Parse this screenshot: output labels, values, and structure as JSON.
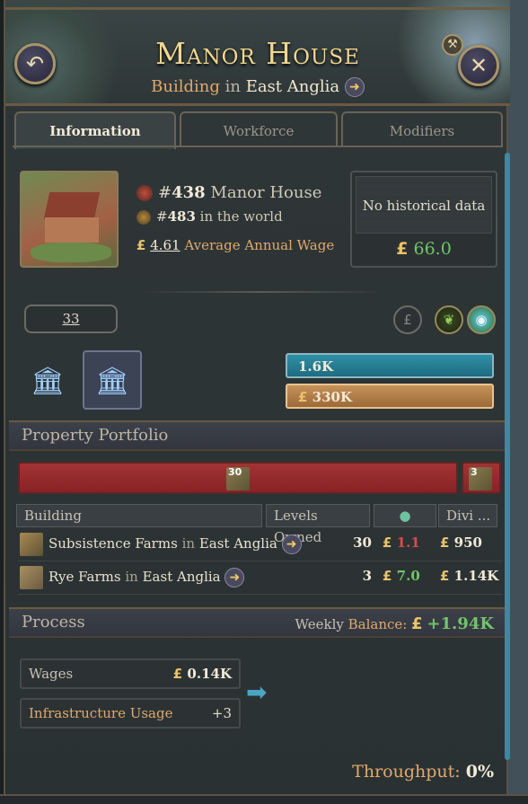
{
  "header": {
    "title": "Manor House",
    "subtitle_type": "Building",
    "subtitle_in": "in",
    "subtitle_location": "East Anglia",
    "goto_icon": "arrow-right"
  },
  "tabs": [
    {
      "label": "Information",
      "active": true
    },
    {
      "label": "Workforce",
      "active": false
    },
    {
      "label": "Modifiers",
      "active": false
    }
  ],
  "info": {
    "rank_hash": "#",
    "rank_value": "438",
    "rank_name": "Manor House",
    "world_rank_hash": "#",
    "world_rank_value": "483",
    "world_rank_suffix": "in the world",
    "wage_currency": "£",
    "wage_value": "4.61",
    "wage_label": "Average Annual Wage",
    "history_text": "No historical data",
    "history_currency": "£",
    "history_value": "66.0",
    "levels": "33",
    "bar_blue_value": "1.6K",
    "bar_gold_currency": "£",
    "bar_gold_value": "330K"
  },
  "portfolio": {
    "title": "Property Portfolio",
    "owner_main_count": "30",
    "owner_small_count": "3",
    "columns": [
      "Building",
      "Levels Owned",
      "Divi ..."
    ],
    "rows": [
      {
        "name": "Subsistence Farms",
        "in": "in",
        "location": "East Anglia",
        "levels": "30",
        "profit_currency": "£",
        "profit": "1.1",
        "profit_color": "red",
        "div_currency": "£",
        "dividend": "950"
      },
      {
        "name": "Rye Farms",
        "in": "in",
        "location": "East Anglia",
        "levels": "3",
        "profit_currency": "£",
        "profit": "7.0",
        "profit_color": "green",
        "div_currency": "£",
        "dividend": "1.14K"
      }
    ]
  },
  "process": {
    "title": "Process",
    "weekly_label": "Weekly",
    "balance_label": "Balance:",
    "balance_currency": "£",
    "balance_value": "+1.94K",
    "wages_label": "Wages",
    "wages_currency": "£",
    "wages_value": "0.14K",
    "infra_label": "Infrastructure Usage",
    "infra_value": "+3",
    "throughput_label": "Throughput:",
    "throughput_value": "0%"
  },
  "colors": {
    "title_gold": "#f0d690",
    "positive_green": "#72c46a",
    "negative_red": "#e04848",
    "accent_orange": "#e0a96b"
  }
}
